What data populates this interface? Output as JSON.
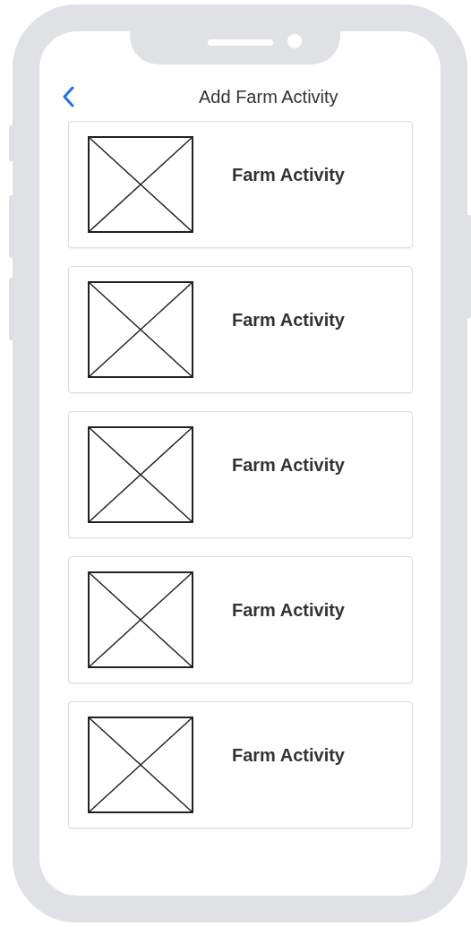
{
  "header": {
    "title": "Add Farm Activity"
  },
  "activities": [
    {
      "label": "Farm Activity"
    },
    {
      "label": "Farm Activity"
    },
    {
      "label": "Farm Activity"
    },
    {
      "label": "Farm Activity"
    },
    {
      "label": "Farm Activity"
    }
  ]
}
